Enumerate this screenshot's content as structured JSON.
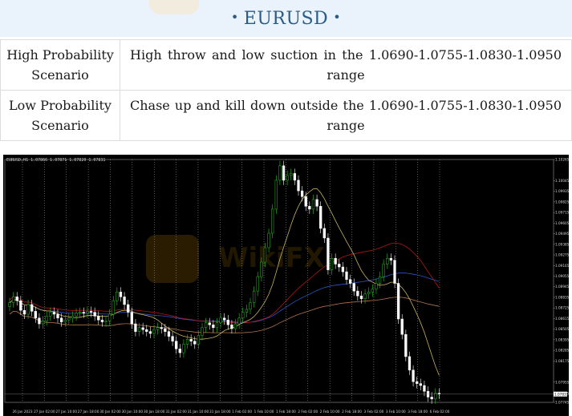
{
  "header": {
    "title": "EURUSD"
  },
  "scenarios": [
    {
      "label": "High Probability Scenario",
      "value": "High throw and low suction in the 1.0690-1.0755-1.0830-1.0950 range"
    },
    {
      "label": "Low Probability Scenario",
      "value": "Chase up and kill down outside the 1.0690-1.0755-1.0830-1.0950 range"
    }
  ],
  "chart_data": {
    "type": "candlestick",
    "symbol_info": "EURUSD,H1  1.07866 1.07871 1.07820 1.07831",
    "x_ticks": [
      "26 Jan 2023",
      "27 Jan 02:00",
      "27 Jan 10:00",
      "27 Jan 18:00",
      "30 Jan 02:00",
      "30 Jan 10:00",
      "30 Jan 18:00",
      "31 Jan 02:00",
      "31 Jan 10:00",
      "31 Jan 18:00",
      "1 Feb 02:00",
      "1 Feb 10:00",
      "1 Feb 18:00",
      "2 Feb 02:00",
      "2 Feb 10:00",
      "2 Feb 18:00",
      "3 Feb 02:00",
      "3 Feb 10:00",
      "3 Feb 18:00",
      "6 Feb 02:00"
    ],
    "y_ticks": [
      "1.10265",
      "1.10045",
      "1.09935",
      "1.09825",
      "1.09715",
      "1.09605",
      "1.09495",
      "1.09385",
      "1.09275",
      "1.09165",
      "1.09055",
      "1.08945",
      "1.08835",
      "1.08725",
      "1.08615",
      "1.08505",
      "1.08395",
      "1.08285",
      "1.08175",
      "1.07955",
      "1.07835",
      "1.07745"
    ],
    "ylim": [
      1.07745,
      1.10265
    ],
    "last_price_label": "1.07831",
    "series_colors": {
      "up": "#25c21f",
      "down": "#ffffff",
      "ma_fast": "#c9b25a",
      "ma_mid": "#b01616",
      "ma_slow": "#2a55c8",
      "ma_long": "#b2744a"
    },
    "close": [
      1.0878,
      1.0884,
      1.088,
      1.087,
      1.0866,
      1.0876,
      1.0869,
      1.0862,
      1.0856,
      1.0859,
      1.0864,
      1.0868,
      1.0866,
      1.0862,
      1.0858,
      1.086,
      1.0862,
      1.0864,
      1.0867,
      1.0868,
      1.0867,
      1.0869,
      1.0868,
      1.0864,
      1.086,
      1.0858,
      1.0859,
      1.0866,
      1.088,
      1.0889,
      1.0884,
      1.0876,
      1.0868,
      1.0856,
      1.0848,
      1.0852,
      1.085,
      1.0848,
      1.0846,
      1.085,
      1.0852,
      1.0851,
      1.0848,
      1.0843,
      1.0838,
      1.083,
      1.0826,
      1.0835,
      1.084,
      1.0838,
      1.0835,
      1.0844,
      1.0852,
      1.0857,
      1.0855,
      1.0852,
      1.0857,
      1.0862,
      1.086,
      1.0855,
      1.0851,
      1.0856,
      1.0862,
      1.0868,
      1.0871,
      1.0878,
      1.089,
      1.0905,
      1.092,
      1.0935,
      1.095,
      1.0975,
      1.1005,
      1.102,
      1.1005,
      1.101,
      1.1012,
      1.1005,
      1.0994,
      1.0988,
      1.0978,
      1.0975,
      1.0985,
      1.0978,
      1.0955,
      1.0945,
      1.0912,
      1.0924,
      1.0918,
      1.0915,
      1.091,
      1.0902,
      1.0898,
      1.089,
      1.0885,
      1.0882,
      1.0887,
      1.0889,
      1.0892,
      1.0898,
      1.0905,
      1.0918,
      1.0924,
      1.0922,
      1.0898,
      1.0861,
      1.0845,
      1.0822,
      1.0808,
      1.0796,
      1.0794,
      1.0792,
      1.0786,
      1.078,
      1.0778,
      1.0784,
      1.0783
    ]
  }
}
